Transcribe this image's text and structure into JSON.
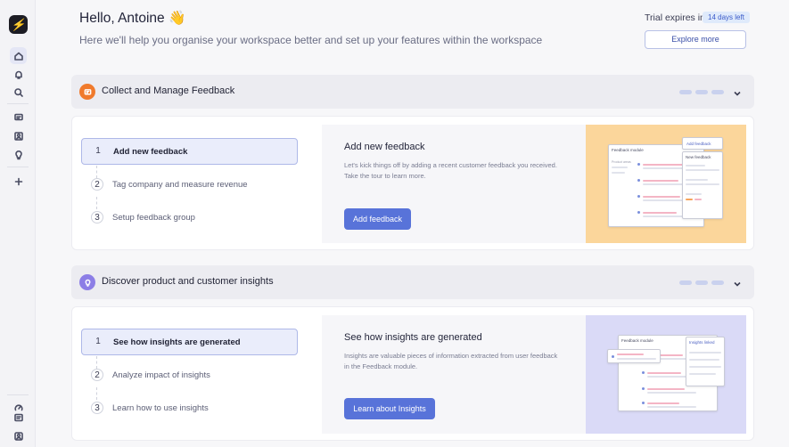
{
  "header": {
    "greeting": "Hello, Antoine 👋",
    "subtitle": "Here we'll help you organise your workspace better and set up your features within the workspace",
    "trial_label": "Trial expires in",
    "trial_badge": "14 days left",
    "explore_label": "Explore more"
  },
  "sections": [
    {
      "title": "Collect and Manage Feedback",
      "icon": "feedback-icon",
      "icon_color": "#f07a2c",
      "steps": [
        {
          "num": "1",
          "label": "Add new feedback"
        },
        {
          "num": "2",
          "label": "Tag company and measure revenue"
        },
        {
          "num": "3",
          "label": "Setup feedback group"
        }
      ],
      "detail_title": "Add new feedback",
      "detail_desc": "Let's kick things off by adding a recent customer feedback you received. Take the tour to learn more.",
      "button_label": "Add feedback",
      "illustration_bg": "#fbd69b",
      "mock_main_title": "Feedback module",
      "mock_filter": "Product areas",
      "mock_side_button": "Add feedback",
      "mock_side_title": "New feedback"
    },
    {
      "title": "Discover product and customer insights",
      "icon": "lightbulb-icon",
      "icon_color": "#8c7ee6",
      "steps": [
        {
          "num": "1",
          "label": "See how insights are generated"
        },
        {
          "num": "2",
          "label": "Analyze impact of insights"
        },
        {
          "num": "3",
          "label": "Learn how to use insights"
        }
      ],
      "detail_title": "See how insights are generated",
      "detail_desc": "Insights are valuable pieces of information extracted from user feedback in the Feedback module.",
      "button_label": "Learn about Insights",
      "illustration_bg": "#dadaf7",
      "mock_main_title": "Feedback module",
      "mock_side_title": "Insights linked"
    }
  ],
  "colors": {
    "accent": "#5873d9",
    "active_step_bg": "#eaedfb",
    "section_header_bg": "#ececf1"
  }
}
